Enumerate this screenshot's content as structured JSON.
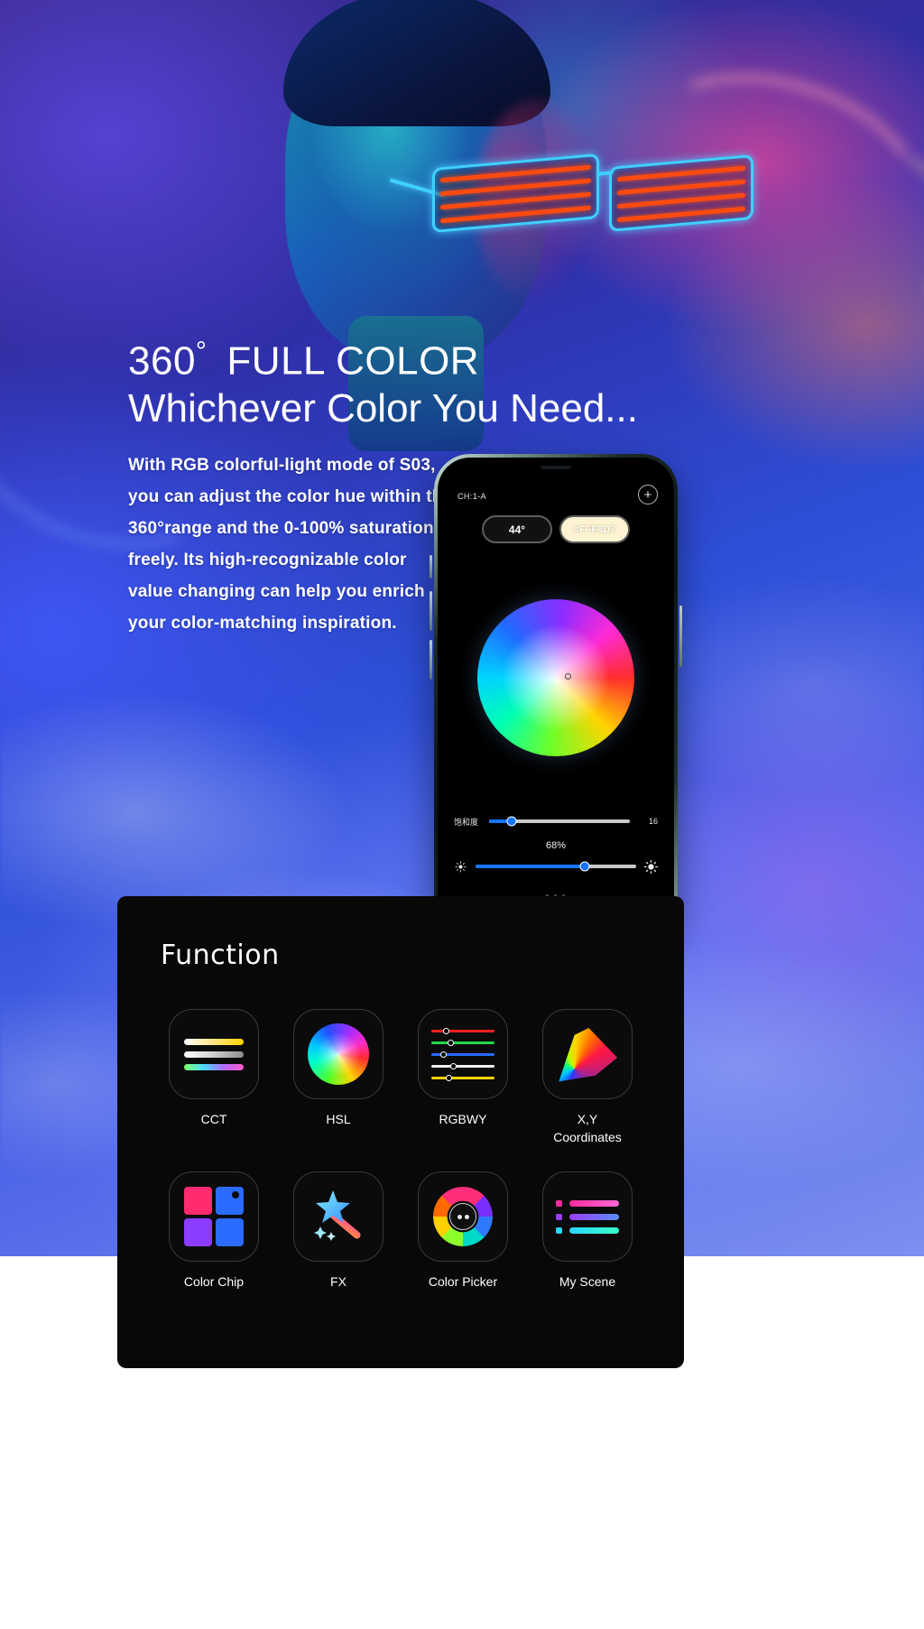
{
  "hero": {
    "headline_main": "360",
    "headline_degree": "°",
    "headline_rest": "FULL COLOR",
    "headline_sub": "Whichever Color You Need...",
    "body": "With RGB colorful-light mode of S03, you can adjust the color hue within the 360°range and the 0-100% saturation freely. Its high-recognizable color value changing can help you enrich your color-matching inspiration."
  },
  "phone": {
    "channel_label": "CH:1-A",
    "add_button": "+",
    "hue_chip": "44°",
    "hex_chip": "#FFF8D7",
    "saturation_label": "饱和度",
    "saturation_value": "16",
    "brightness_value": "68%"
  },
  "function": {
    "title": "Function",
    "items": [
      {
        "label": "CCT",
        "icon": "cct-icon"
      },
      {
        "label": "HSL",
        "icon": "hsl-color-wheel-icon"
      },
      {
        "label": "RGBWY",
        "icon": "rgbwy-sliders-icon"
      },
      {
        "label": "X,Y\nCoordinates",
        "icon": "xy-gamut-icon"
      },
      {
        "label": "Color Chip",
        "icon": "color-chip-icon"
      },
      {
        "label": "FX",
        "icon": "magic-wand-icon"
      },
      {
        "label": "Color Picker",
        "icon": "color-picker-icon"
      },
      {
        "label": "My Scene",
        "icon": "scene-list-icon"
      }
    ]
  },
  "colors": {
    "panel_bg": "#080808",
    "accent_blue": "#1575ff",
    "hex_chip_bg": "#FDF3D2"
  }
}
